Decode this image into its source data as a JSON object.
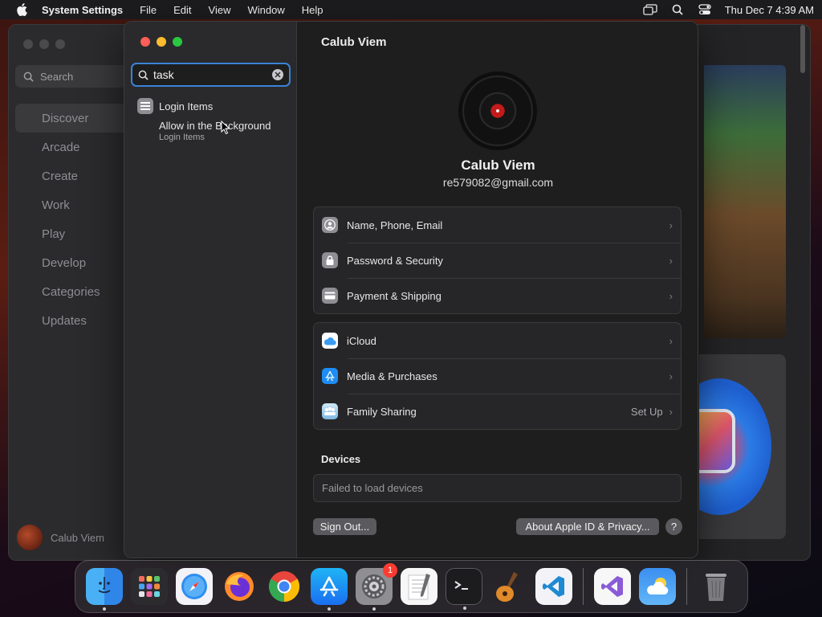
{
  "menubar": {
    "app_name": "System Settings",
    "menus": [
      "File",
      "Edit",
      "View",
      "Window",
      "Help"
    ],
    "datetime": "Thu Dec 7  4:39 AM"
  },
  "appstore": {
    "search_placeholder": "Search",
    "nav": [
      "Discover",
      "Arcade",
      "Create",
      "Work",
      "Play",
      "Develop",
      "Categories",
      "Updates"
    ],
    "active_nav": "Discover",
    "user_name": "Calub Viem"
  },
  "settings": {
    "search_value": "task",
    "results": {
      "title": "Login Items",
      "sub_title": "Allow in the Background",
      "sub_caption": "Login Items"
    },
    "header_title": "Calub Viem",
    "profile": {
      "name": "Calub Viem",
      "email": "re579082@gmail.com"
    },
    "group1": [
      {
        "label": "Name, Phone, Email",
        "icon": "person-circle-icon"
      },
      {
        "label": "Password & Security",
        "icon": "lock-icon"
      },
      {
        "label": "Payment & Shipping",
        "icon": "credit-card-icon"
      }
    ],
    "group2": [
      {
        "label": "iCloud",
        "icon": "icloud-icon"
      },
      {
        "label": "Media & Purchases",
        "icon": "app-store-icon"
      },
      {
        "label": "Family Sharing",
        "icon": "family-sharing-icon",
        "trail": "Set Up"
      }
    ],
    "devices_heading": "Devices",
    "devices_status": "Failed to load devices",
    "sign_out": "Sign Out...",
    "about": "About Apple ID & Privacy...",
    "help": "?"
  },
  "dock": {
    "apps": [
      "Finder",
      "Launchpad",
      "Safari",
      "Firefox",
      "Chrome",
      "App Store",
      "System Settings",
      "TextEdit",
      "Terminal",
      "GarageBand",
      "Visual Studio Code",
      "Visual Studio",
      "Weather",
      "Trash"
    ],
    "settings_badge": "1"
  }
}
